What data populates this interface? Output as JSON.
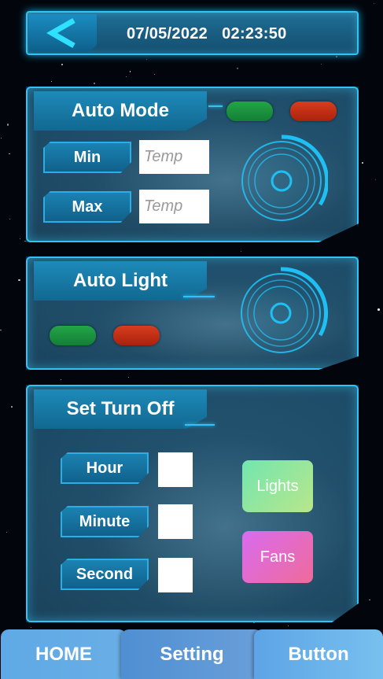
{
  "header": {
    "back_icon": "chevron-left-icon",
    "date": "07/05/2022",
    "time": "02:23:50"
  },
  "auto_mode": {
    "title": "Auto Mode",
    "on_color": "#1b9a43",
    "off_color": "#c8300f",
    "min_label": "Min",
    "max_label": "Max",
    "min_placeholder": "Temp",
    "max_placeholder": "Temp",
    "dial_icon": "dial-knob-icon"
  },
  "auto_light": {
    "title": "Auto Light",
    "on_color": "#1b9a43",
    "off_color": "#c8300f",
    "dial_icon": "dial-knob-icon"
  },
  "set_turn_off": {
    "title": "Set Turn Off",
    "hour_label": "Hour",
    "minute_label": "Minute",
    "second_label": "Second",
    "lights_label": "Lights",
    "fans_label": "Fans"
  },
  "bottom_nav": {
    "home": "HOME",
    "setting": "Setting",
    "button": "Button"
  },
  "theme": {
    "accent": "#2fc3f6",
    "panel": "#1a4a66"
  }
}
